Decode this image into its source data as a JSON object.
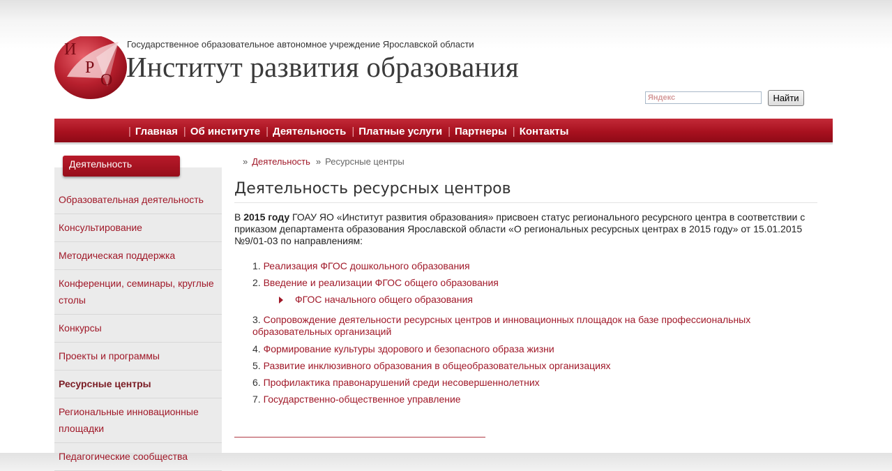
{
  "header": {
    "org_line": "Государственное образовательное автономное учреждение Ярославской области",
    "site_title": "Институт развития образования",
    "logo_letters": [
      "И",
      "Р",
      "О"
    ]
  },
  "search": {
    "placeholder": "Яндекс",
    "button_label": "Найти"
  },
  "nav": {
    "items": [
      "Главная",
      "Об институте",
      "Деятельность",
      "Платные услуги",
      "Партнеры",
      "Контакты"
    ]
  },
  "sidebar": {
    "tab_label": "Деятельность",
    "items": [
      "Образовательная деятельность",
      "Консультирование",
      "Методическая поддержка",
      "Конференции, семинары, круглые столы",
      "Конкурсы",
      "Проекты и программы",
      "Ресурсные центры",
      "Региональные инновационные площадки",
      "Педагогические сообщества"
    ],
    "active_item": "Ресурсные центры"
  },
  "breadcrumb": {
    "link": "Деятельность",
    "current": "Ресурсные центры"
  },
  "content": {
    "title": "Деятельность ресурсных центров",
    "intro_prefix": "В ",
    "intro_year": "2015 году",
    "intro_rest": "  ГОАУ ЯО «Институт развития образования» присвоен статус регионального ресурсного центра в соответствии с приказом департамента образования Ярославской области «О региональных ресурсных центрах в 2015 году» от 15.01.2015 №9/01-03 по направлениям:",
    "list": [
      {
        "num": "1.",
        "text": "Реализация ФГОС дошкольного образования"
      },
      {
        "num": "2.",
        "text": "Введение и реализации  ФГОС общего образования"
      },
      {
        "num": "3.",
        "text": "Сопровождение деятельности ресурсных центров и инновационных площадок на базе профессиональных образовательных организаций"
      },
      {
        "num": "4.",
        "text": "Формирование  культуры здорового и безопасного образа жизни"
      },
      {
        "num": "5.",
        "text": "Развитие инклюзивного образования в общеобразовательных организациях"
      },
      {
        "num": "6.",
        "text": "Профилактика правонарушений среди несовершеннолетних"
      },
      {
        "num": "7.",
        "text": "Государственно-общественное управление"
      }
    ],
    "sub_item": "ФГОС начального общего образования"
  },
  "colors": {
    "brand_red": "#a8111f",
    "link": "#a01828"
  }
}
